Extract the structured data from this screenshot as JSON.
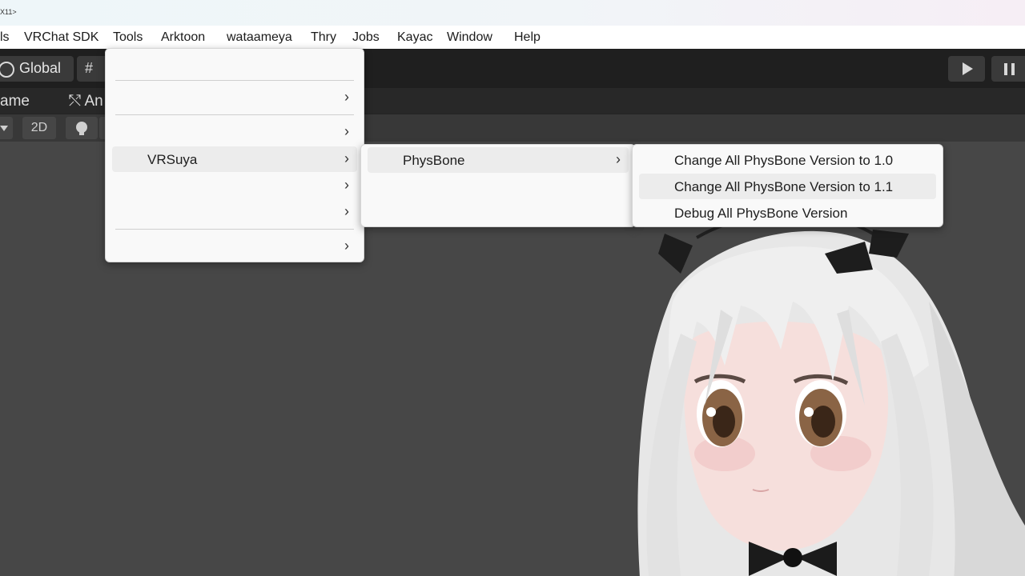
{
  "window_title": "X11>",
  "menubar": {
    "items": [
      "ls",
      "VRChat SDK",
      "Tools",
      "Arktoon",
      "wataameya",
      "Thry",
      "Jobs",
      "Kayac",
      "Window",
      "Help"
    ]
  },
  "toolbar": {
    "global_label": "Global",
    "globe_icon": "globe-icon",
    "grid_icon": "grid-snap-icon",
    "play_icon": "play-icon",
    "pause_icon": "pause-icon"
  },
  "tabs": {
    "game_label": "ame",
    "animator_label": "An"
  },
  "scene_toolbar": {
    "mode_2d": "2D",
    "light_icon": "lightbulb-icon"
  },
  "tools_menu": {
    "items": [
      {
        "label": "",
        "submenu": false
      },
      {
        "label": "",
        "submenu": true
      },
      {
        "label": "",
        "submenu": true
      },
      {
        "label": "VRSuya",
        "submenu": true,
        "highlighted": true
      },
      {
        "label": "",
        "submenu": true
      },
      {
        "label": "",
        "submenu": true
      },
      {
        "label": "",
        "submenu": true
      }
    ],
    "arrow_glyph": "›"
  },
  "vrsuya_menu": {
    "items": [
      {
        "label": "PhysBone",
        "submenu": true,
        "highlighted": true
      }
    ],
    "arrow_glyph": "›"
  },
  "physbone_menu": {
    "items": [
      {
        "label": "Change All PhysBone Version to 1.0",
        "highlighted": false
      },
      {
        "label": "Change All PhysBone Version to 1.1",
        "highlighted": true
      },
      {
        "label": "Debug All PhysBone Version",
        "highlighted": false
      }
    ]
  },
  "colors": {
    "viewport_bg": "#474747",
    "menu_bg": "#f9f9f9",
    "menu_highlight": "#ececec",
    "toolbar_bg": "#1f1f1f"
  }
}
